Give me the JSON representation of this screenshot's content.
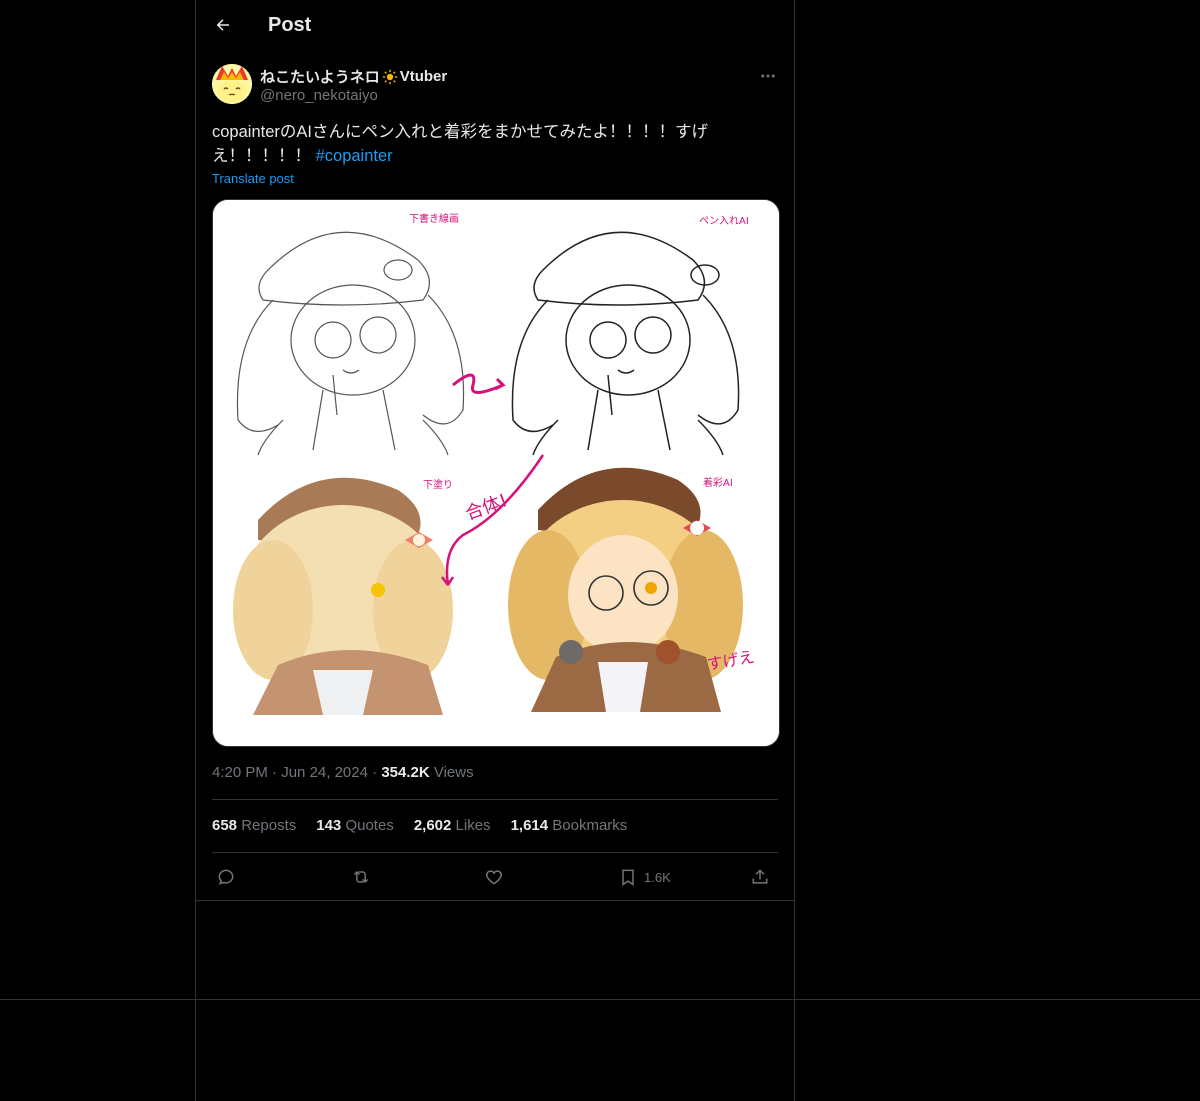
{
  "header": {
    "title": "Post"
  },
  "author": {
    "name": "ねこたいようネロ",
    "name_suffix": "Vtuber",
    "handle": "@nero_nekotaiyo"
  },
  "post": {
    "text": "copainterのAIさんにペン入れと着彩をまかせてみたよ！！！！すげえ！！！！！ ",
    "hashtag": "#copainter",
    "translate_label": "Translate post"
  },
  "media": {
    "panel_labels": [
      "下書き線画",
      "ペン入れAI",
      "下塗り",
      "着彩AI"
    ],
    "annotations": [
      "合体!",
      "すげえ"
    ]
  },
  "meta": {
    "time": "4:20 PM",
    "date": "Jun 24, 2024",
    "views_count": "354.2K",
    "views_label": "Views"
  },
  "stats": [
    {
      "count": "658",
      "label": "Reposts"
    },
    {
      "count": "143",
      "label": "Quotes"
    },
    {
      "count": "2,602",
      "label": "Likes"
    },
    {
      "count": "1,614",
      "label": "Bookmarks"
    }
  ],
  "actions": {
    "bookmark_count": "1.6K"
  },
  "icons": [
    "back-arrow-icon",
    "sun-icon",
    "more-icon",
    "reply-icon",
    "repost-icon",
    "like-icon",
    "bookmark-icon",
    "share-icon"
  ],
  "colors": {
    "background": "#000000",
    "link": "#1d9bf0",
    "muted": "#71767b",
    "text": "#e7e9ea",
    "border": "#2f3336"
  }
}
